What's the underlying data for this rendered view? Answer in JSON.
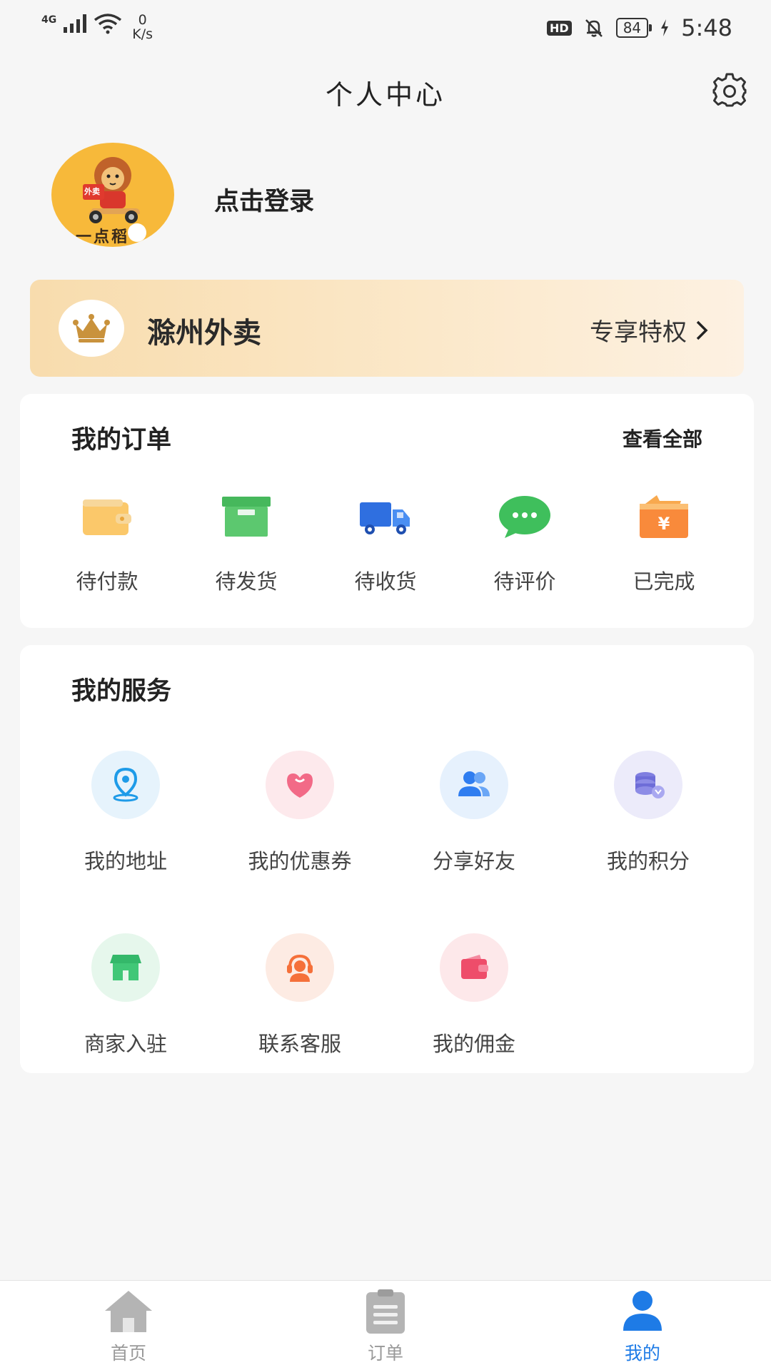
{
  "status_bar": {
    "network": "4G",
    "speed_value": "0",
    "speed_unit": "K/s",
    "hd": "HD",
    "battery": "84",
    "time": "5:48"
  },
  "header": {
    "title": "个人中心"
  },
  "profile": {
    "login_text": "点击登录",
    "avatar_brand": "一点稻",
    "avatar_tag": "外卖"
  },
  "vip": {
    "name": "滁州外卖",
    "link": "专享特权"
  },
  "orders": {
    "title": "我的订单",
    "view_all": "查看全部",
    "items": [
      {
        "label": "待付款",
        "icon": "wallet-icon"
      },
      {
        "label": "待发货",
        "icon": "box-icon"
      },
      {
        "label": "待收货",
        "icon": "truck-icon"
      },
      {
        "label": "待评价",
        "icon": "chat-icon"
      },
      {
        "label": "已完成",
        "icon": "yen-wallet-icon"
      }
    ]
  },
  "services": {
    "title": "我的服务",
    "items": [
      {
        "label": "我的地址",
        "icon": "location-icon"
      },
      {
        "label": "我的优惠券",
        "icon": "coupon-icon"
      },
      {
        "label": "分享好友",
        "icon": "users-icon"
      },
      {
        "label": "我的积分",
        "icon": "points-icon"
      },
      {
        "label": "商家入驻",
        "icon": "store-icon"
      },
      {
        "label": "联系客服",
        "icon": "headset-icon"
      },
      {
        "label": "我的佣金",
        "icon": "wallet-icon"
      }
    ]
  },
  "bottom_nav": {
    "items": [
      {
        "label": "首页",
        "icon": "home-icon"
      },
      {
        "label": "订单",
        "icon": "clipboard-icon"
      },
      {
        "label": "我的",
        "icon": "user-icon"
      }
    ],
    "active_color": "#1e7be6",
    "inactive_color": "#999999"
  }
}
